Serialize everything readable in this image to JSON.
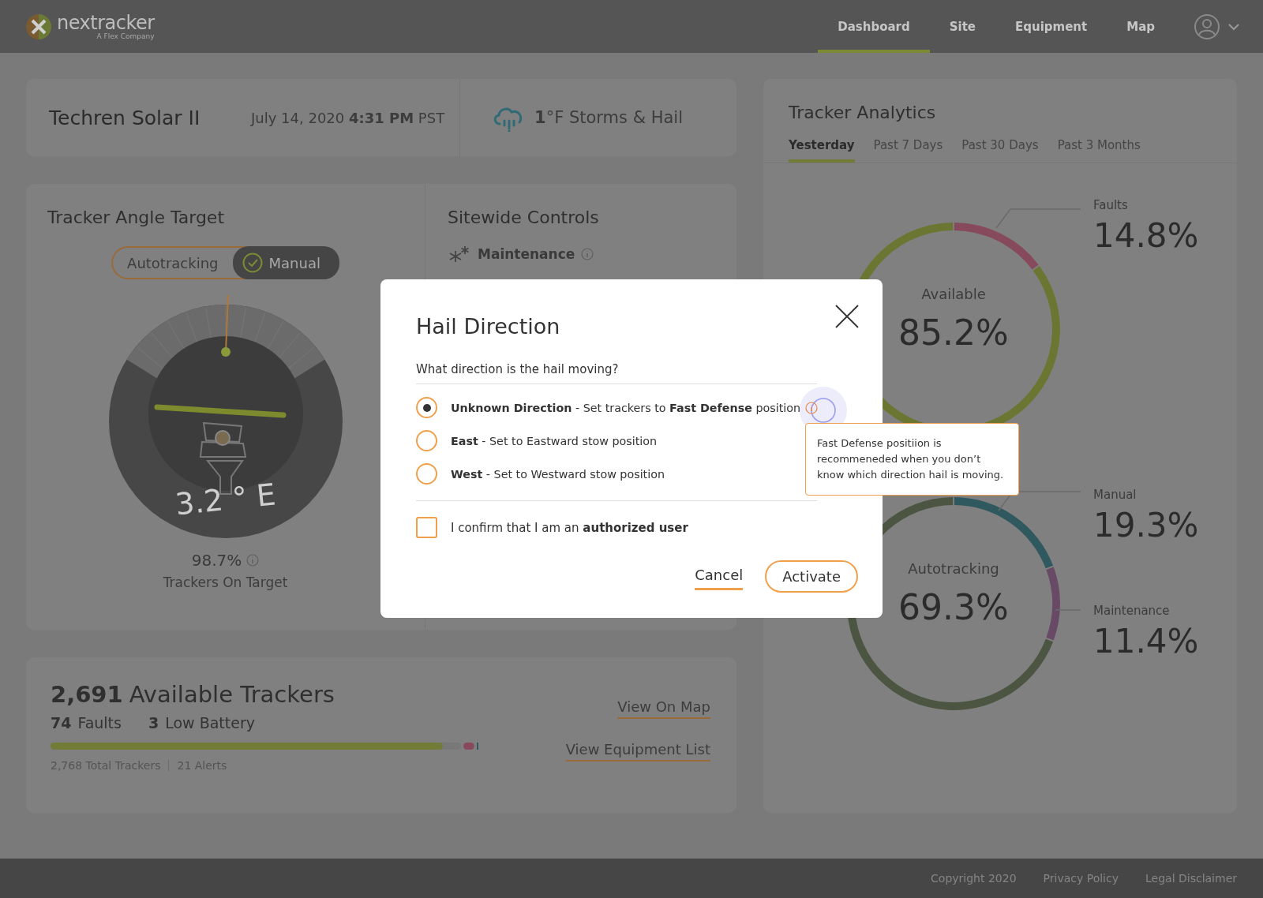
{
  "header": {
    "logo_text": "nextracker",
    "logo_subtext": "A Flex Company",
    "nav": [
      {
        "label": "Dashboard",
        "selected": true
      },
      {
        "label": "Site",
        "selected": false
      },
      {
        "label": "Equipment",
        "selected": false
      },
      {
        "label": "Map",
        "selected": false
      }
    ]
  },
  "site_card": {
    "site_name": "Techren Solar II",
    "datetime": "July 14, 2020 **4:31 PM** PST",
    "weather": "**1**°F Storms & Hail"
  },
  "angle_card": {
    "title": "Tracker Angle Target",
    "mode_toggle": [
      {
        "label": "Autotracking",
        "selected": false
      },
      {
        "label": "Manual",
        "selected": true
      }
    ],
    "gauge_reading": "3.2 ° E",
    "on_target_value": "98.7%",
    "on_target_label": "Trackers On Target"
  },
  "sitewide_controls": {
    "title": "Sitewide Controls",
    "items": [
      {
        "label": "Maintenance"
      }
    ]
  },
  "trackers_card": {
    "available_count": "2,691",
    "available_label": "Available Trackers",
    "counts": [
      "**74**  Faults",
      "**3**  Low Battery"
    ],
    "level": 0.955,
    "total": "2,768 Total Trackers",
    "alerts": "21 Alerts",
    "links": [
      "View On Map",
      "View Equipment List"
    ]
  },
  "analytics": {
    "title": "Tracker Analytics",
    "tabs": [
      {
        "label": "Yesterday",
        "selected": true
      },
      {
        "label": "Past 7 Days",
        "selected": false
      },
      {
        "label": "Past 30 Days",
        "selected": false
      },
      {
        "label": "Past 3 Months",
        "selected": false
      }
    ],
    "availability": {
      "chart_data": {
        "type": "donut",
        "categories": [
          "Available",
          "Faults"
        ],
        "values": [
          85.2,
          14.8
        ],
        "colors": [
          "#6c7633",
          "#874a5c"
        ],
        "value_labels": [
          "85.2%",
          "14.8%"
        ]
      }
    },
    "operation_mode": {
      "chart_data": {
        "type": "donut",
        "categories": [
          "Autotracking",
          "Manual",
          "Maintenance"
        ],
        "values": [
          69.3,
          19.3,
          11.4
        ],
        "colors": [
          "#4b5541",
          "#30595f",
          "#684a67"
        ],
        "value_labels": [
          "69.3%",
          "19.3%",
          "11.4%"
        ]
      }
    }
  },
  "footer": {
    "links": [
      "Copyright 2020",
      "Privacy Policy",
      "Legal Disclaimer"
    ]
  },
  "modal": {
    "title": "Hail Direction",
    "question": "What direction is the hail moving?",
    "options": [
      {
        "label": "**Unknown Direction** - Set trackers to **Fast Defense** position",
        "selected": true,
        "info": true
      },
      {
        "label": "**East** - Set to Eastward stow position",
        "selected": false,
        "info": false
      },
      {
        "label": "**West** - Set to Westward stow position",
        "selected": false,
        "info": false
      }
    ],
    "confirm": {
      "label": "I confirm that I am an **authorized user**",
      "checked": false
    },
    "buttons": [
      {
        "label": "Cancel",
        "kind": "text"
      },
      {
        "label": "Activate",
        "kind": "outline"
      }
    ]
  },
  "tooltip": {
    "text": "Fast Defense positiion is recommeneded when you don’t know which direction hail is moving."
  }
}
